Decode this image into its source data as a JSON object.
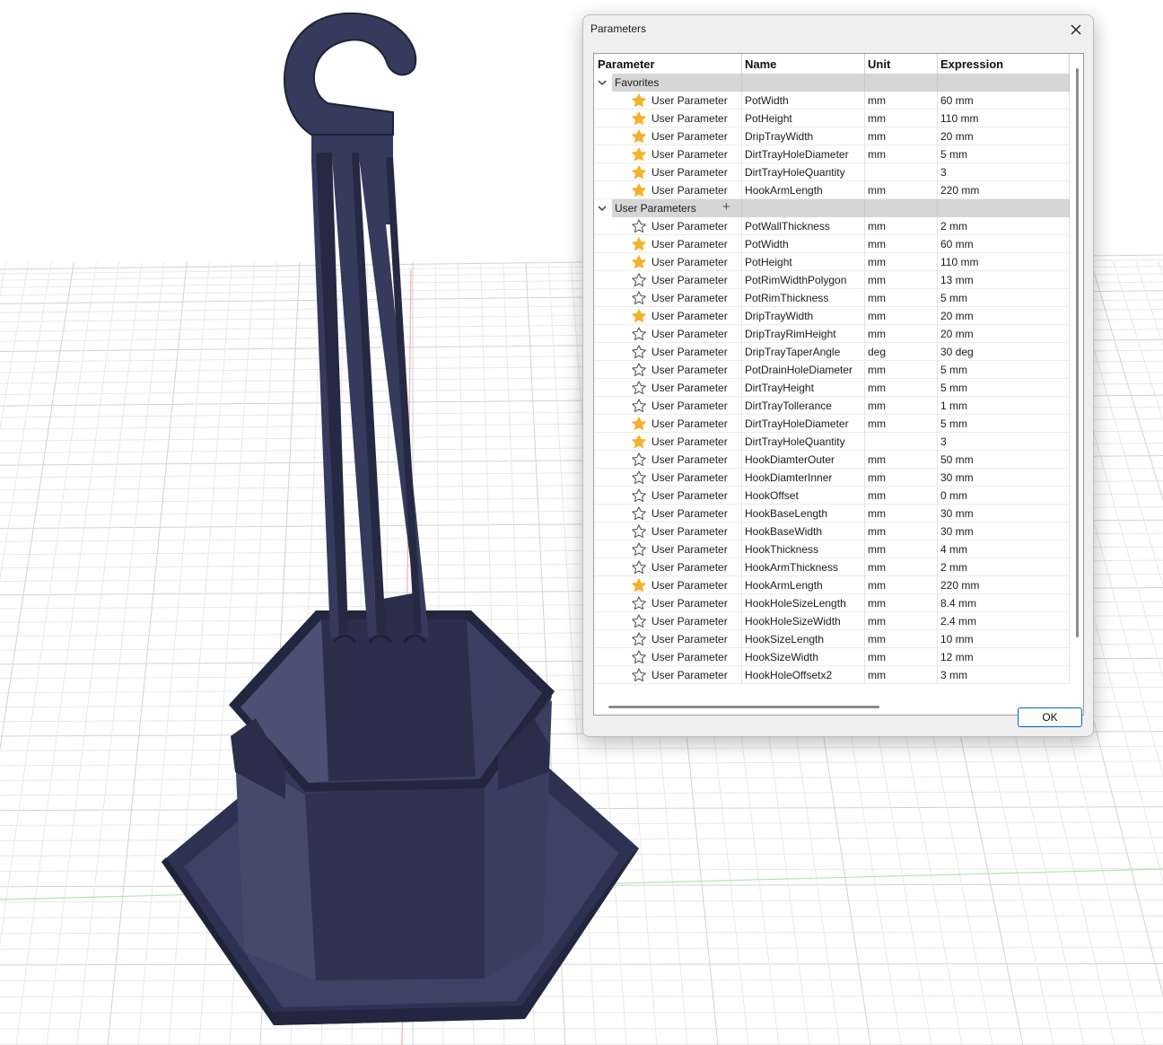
{
  "dialog": {
    "title": "Parameters",
    "ok_label": "OK"
  },
  "columns": {
    "parameter": "Parameter",
    "name": "Name",
    "unit": "Unit",
    "expression": "Expression"
  },
  "groups": [
    {
      "label": "Favorites",
      "show_add": false,
      "rows": [
        {
          "favorite": true,
          "type": "User Parameter",
          "name": "PotWidth",
          "unit": "mm",
          "expression": "60 mm"
        },
        {
          "favorite": true,
          "type": "User Parameter",
          "name": "PotHeight",
          "unit": "mm",
          "expression": "110 mm"
        },
        {
          "favorite": true,
          "type": "User Parameter",
          "name": "DripTrayWidth",
          "unit": "mm",
          "expression": "20 mm"
        },
        {
          "favorite": true,
          "type": "User Parameter",
          "name": "DirtTrayHoleDiameter",
          "unit": "mm",
          "expression": "5 mm"
        },
        {
          "favorite": true,
          "type": "User Parameter",
          "name": "DirtTrayHoleQuantity",
          "unit": "",
          "expression": "3"
        },
        {
          "favorite": true,
          "type": "User Parameter",
          "name": "HookArmLength",
          "unit": "mm",
          "expression": "220 mm"
        }
      ]
    },
    {
      "label": "User Parameters",
      "show_add": true,
      "rows": [
        {
          "favorite": false,
          "type": "User Parameter",
          "name": "PotWallThickness",
          "unit": "mm",
          "expression": "2 mm"
        },
        {
          "favorite": true,
          "type": "User Parameter",
          "name": "PotWidth",
          "unit": "mm",
          "expression": "60 mm"
        },
        {
          "favorite": true,
          "type": "User Parameter",
          "name": "PotHeight",
          "unit": "mm",
          "expression": "110 mm"
        },
        {
          "favorite": false,
          "type": "User Parameter",
          "name": "PotRimWidthPolygon",
          "unit": "mm",
          "expression": "13 mm"
        },
        {
          "favorite": false,
          "type": "User Parameter",
          "name": "PotRimThickness",
          "unit": "mm",
          "expression": "5 mm"
        },
        {
          "favorite": true,
          "type": "User Parameter",
          "name": "DripTrayWidth",
          "unit": "mm",
          "expression": "20 mm"
        },
        {
          "favorite": false,
          "type": "User Parameter",
          "name": "DripTrayRimHeight",
          "unit": "mm",
          "expression": "20 mm"
        },
        {
          "favorite": false,
          "type": "User Parameter",
          "name": "DripTrayTaperAngle",
          "unit": "deg",
          "expression": "30 deg"
        },
        {
          "favorite": false,
          "type": "User Parameter",
          "name": "PotDrainHoleDiameter",
          "unit": "mm",
          "expression": "5 mm"
        },
        {
          "favorite": false,
          "type": "User Parameter",
          "name": "DirtTrayHeight",
          "unit": "mm",
          "expression": "5 mm"
        },
        {
          "favorite": false,
          "type": "User Parameter",
          "name": "DirtTrayTollerance",
          "unit": "mm",
          "expression": "1 mm"
        },
        {
          "favorite": true,
          "type": "User Parameter",
          "name": "DirtTrayHoleDiameter",
          "unit": "mm",
          "expression": "5 mm"
        },
        {
          "favorite": true,
          "type": "User Parameter",
          "name": "DirtTrayHoleQuantity",
          "unit": "",
          "expression": "3"
        },
        {
          "favorite": false,
          "type": "User Parameter",
          "name": "HookDiamterOuter",
          "unit": "mm",
          "expression": "50 mm"
        },
        {
          "favorite": false,
          "type": "User Parameter",
          "name": "HookDiamterInner",
          "unit": "mm",
          "expression": "30 mm"
        },
        {
          "favorite": false,
          "type": "User Parameter",
          "name": "HookOffset",
          "unit": "mm",
          "expression": "0 mm"
        },
        {
          "favorite": false,
          "type": "User Parameter",
          "name": "HookBaseLength",
          "unit": "mm",
          "expression": "30 mm"
        },
        {
          "favorite": false,
          "type": "User Parameter",
          "name": "HookBaseWidth",
          "unit": "mm",
          "expression": "30 mm"
        },
        {
          "favorite": false,
          "type": "User Parameter",
          "name": "HookThickness",
          "unit": "mm",
          "expression": "4 mm"
        },
        {
          "favorite": false,
          "type": "User Parameter",
          "name": "HookArmThickness",
          "unit": "mm",
          "expression": "2 mm"
        },
        {
          "favorite": true,
          "type": "User Parameter",
          "name": "HookArmLength",
          "unit": "mm",
          "expression": "220 mm"
        },
        {
          "favorite": false,
          "type": "User Parameter",
          "name": "HookHoleSizeLength",
          "unit": "mm",
          "expression": "8.4 mm"
        },
        {
          "favorite": false,
          "type": "User Parameter",
          "name": "HookHoleSizeWidth",
          "unit": "mm",
          "expression": "2.4 mm"
        },
        {
          "favorite": false,
          "type": "User Parameter",
          "name": "HookSizeLength",
          "unit": "mm",
          "expression": "10 mm"
        },
        {
          "favorite": false,
          "type": "User Parameter",
          "name": "HookSizeWidth",
          "unit": "mm",
          "expression": "12 mm"
        },
        {
          "favorite": false,
          "type": "User Parameter",
          "name": "HookHoleOffsetx2",
          "unit": "mm",
          "expression": "3 mm"
        }
      ]
    }
  ],
  "colors": {
    "model": "#363a5c",
    "model_dark": "#262943",
    "model_light": "#4a4f72",
    "grid_line": "#dcdcdc",
    "axis_x": "#b3e6b3",
    "axis_y": "#f2b0b0",
    "favorite_star": "#f6b12a",
    "group_bar": "#d6d6d6",
    "ok_border": "#0067c0"
  }
}
